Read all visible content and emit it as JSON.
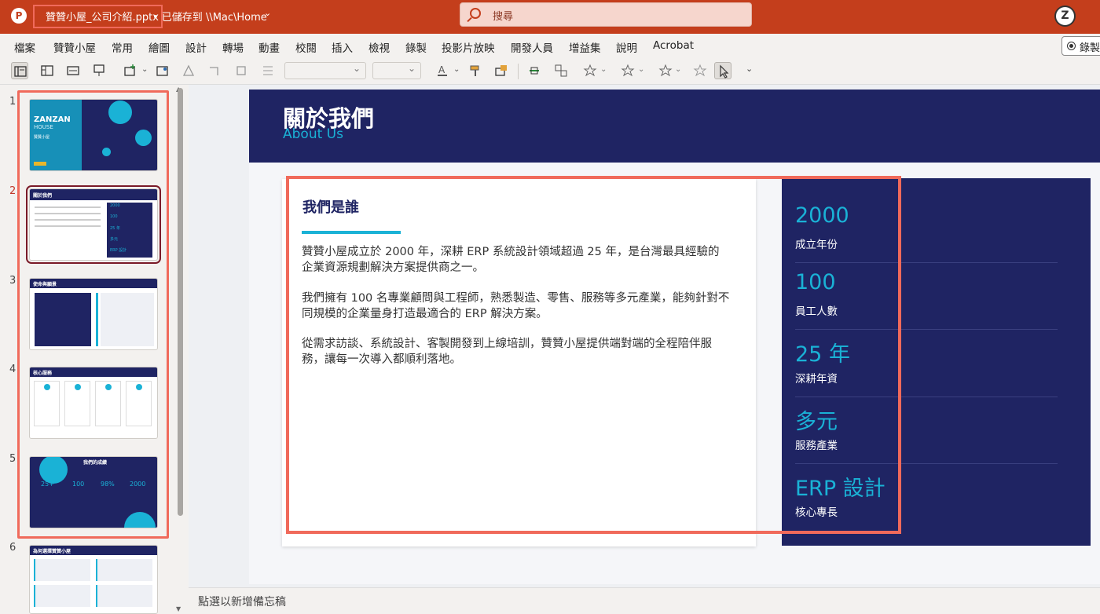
{
  "titlebar": {
    "app_icon": "powerpoint-icon",
    "doc_title": "贊贊小屋_公司介紹.pptx",
    "save_state": "• 已儲存到 \\\\Mac\\Home",
    "search_placeholder": "搜尋",
    "avatar_letter": "Z"
  },
  "menu": {
    "items": [
      "檔案",
      "贊贊小屋",
      "常用",
      "繪圖",
      "設計",
      "轉場",
      "動畫",
      "校閱",
      "插入",
      "檢視",
      "錄製",
      "投影片放映",
      "開發人員",
      "增益集",
      "說明",
      "Acrobat"
    ],
    "record_label": "錄製"
  },
  "toolbar": {
    "icons": [
      "normal-view-icon",
      "outline-view-icon",
      "slide-sorter-icon",
      "reading-view-icon",
      "new-slide-icon",
      "picture-icon",
      "shapes-icon",
      "crop-icon",
      "align-icon",
      "line-spacing-icon",
      "font-color-icon",
      "format-painter-icon",
      "replace-picture-icon",
      "animation-icon",
      "group-icon",
      "star-icon",
      "select-pointer-icon"
    ]
  },
  "thumbnails": [
    {
      "num": "1",
      "title": "ZANZAN",
      "subtitle": "HOUSE",
      "caption": "贊贊小屋"
    },
    {
      "num": "2",
      "title": "關於我們",
      "stats": [
        "2000",
        "100",
        "25 年",
        "多元",
        "ERP 設計"
      ]
    },
    {
      "num": "3",
      "title": "使命與願景"
    },
    {
      "num": "4",
      "title": "核心服務"
    },
    {
      "num": "5",
      "title": "我們的成績",
      "stats": [
        "25+",
        "100",
        "98%",
        "2000"
      ]
    },
    {
      "num": "6",
      "title": "為何選擇贊贊小屋"
    }
  ],
  "slide": {
    "title": "關於我們",
    "subtitle": "About Us",
    "heading": "我們是誰",
    "paragraphs": [
      "贊贊小屋成立於 2000 年，深耕 ERP 系統設計領域超過 25 年，是台灣最具經驗的企業資源規劃解決方案提供商之一。",
      "我們擁有 100 名專業顧問與工程師，熟悉製造、零售、服務等多元產業，能夠針對不同規模的企業量身打造最適合的 ERP 解決方案。",
      "從需求訪談、系統設計、客製開發到上線培訓，贊贊小屋提供端對端的全程陪伴服務，讓每一次導入都順利落地。"
    ],
    "stats": [
      {
        "value": "2000",
        "label": "成立年份"
      },
      {
        "value": "100",
        "label": "員工人數"
      },
      {
        "value": "25 年",
        "label": "深耕年資"
      },
      {
        "value": "多元",
        "label": "服務產業"
      },
      {
        "value": "ERP 設計",
        "label": "核心專長"
      }
    ]
  },
  "notes": {
    "placeholder": "點選以新增備忘稿"
  },
  "colors": {
    "titlebar": "#c43e1c",
    "slide_navy": "#1f2463",
    "accent_cyan": "#1ab2d6",
    "highlight": "#f06a5b"
  }
}
